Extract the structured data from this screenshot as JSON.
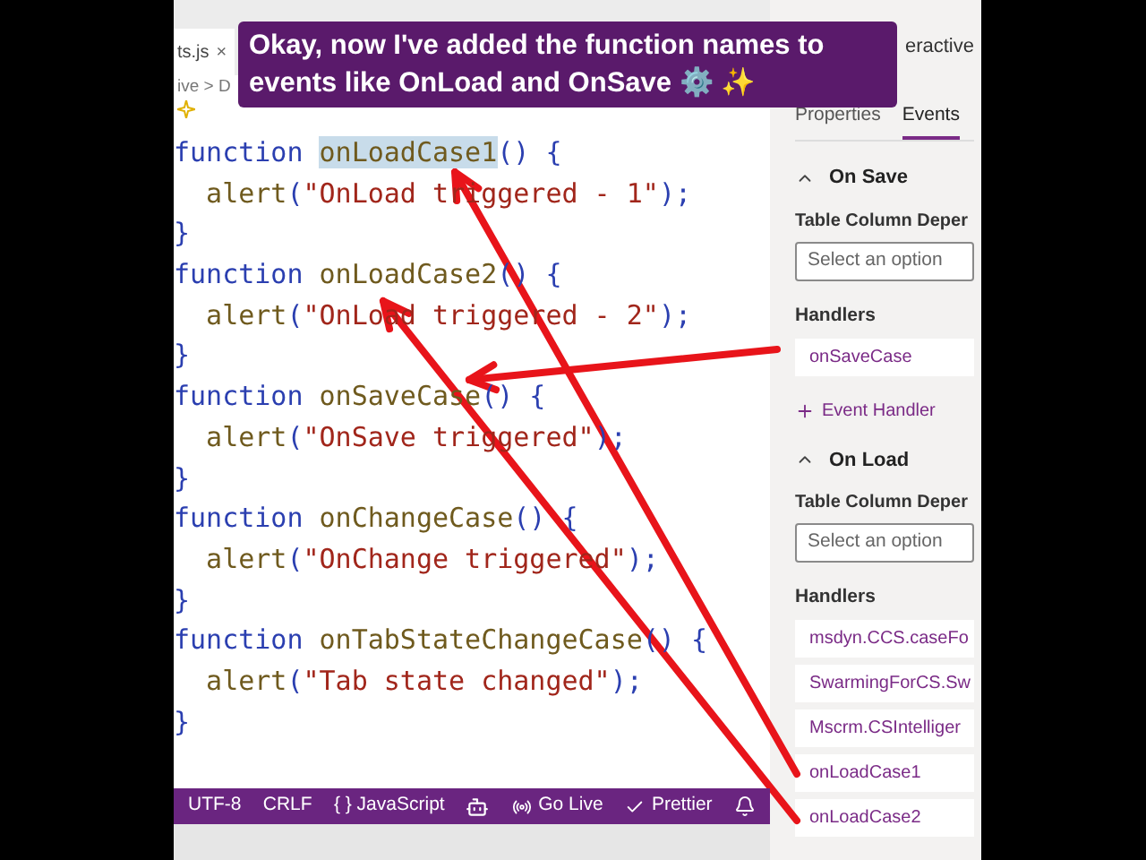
{
  "caption": "Okay, now I've added the function names to events like OnLoad and OnSave ⚙️ ✨",
  "editor": {
    "tab": {
      "label": "ts.js",
      "close": "×"
    },
    "breadcrumb": "ive > D",
    "code_lines": [
      {
        "tokens": [
          {
            "kind": "keyword",
            "text": "function "
          },
          {
            "kind": "name",
            "text": "onLoadCase1",
            "highlighted": true
          },
          {
            "kind": "punct",
            "text": "() {"
          }
        ]
      },
      {
        "tokens": [
          {
            "kind": "call",
            "text": "  alert"
          },
          {
            "kind": "punct",
            "text": "("
          },
          {
            "kind": "string",
            "text": "\"OnLoad triggered - 1\""
          },
          {
            "kind": "punct",
            "text": ");"
          }
        ]
      },
      {
        "tokens": [
          {
            "kind": "punct",
            "text": "}"
          }
        ]
      },
      {
        "tokens": [
          {
            "kind": "keyword",
            "text": "function "
          },
          {
            "kind": "name",
            "text": "onLoadCase2",
            "highlighted": false
          },
          {
            "kind": "punct",
            "text": "() {"
          }
        ]
      },
      {
        "tokens": [
          {
            "kind": "call",
            "text": "  alert"
          },
          {
            "kind": "punct",
            "text": "("
          },
          {
            "kind": "string",
            "text": "\"OnLoad triggered - 2\""
          },
          {
            "kind": "punct",
            "text": ");"
          }
        ]
      },
      {
        "tokens": [
          {
            "kind": "punct",
            "text": "}"
          }
        ]
      },
      {
        "tokens": [
          {
            "kind": "keyword",
            "text": "function "
          },
          {
            "kind": "name",
            "text": "onSaveCase",
            "highlighted": false
          },
          {
            "kind": "punct",
            "text": "() {"
          }
        ]
      },
      {
        "tokens": [
          {
            "kind": "call",
            "text": "  alert"
          },
          {
            "kind": "punct",
            "text": "("
          },
          {
            "kind": "string",
            "text": "\"OnSave triggered\""
          },
          {
            "kind": "punct",
            "text": ");"
          }
        ]
      },
      {
        "tokens": [
          {
            "kind": "punct",
            "text": "}"
          }
        ]
      },
      {
        "tokens": [
          {
            "kind": "keyword",
            "text": "function "
          },
          {
            "kind": "name",
            "text": "onChangeCase",
            "highlighted": false
          },
          {
            "kind": "punct",
            "text": "() {"
          }
        ]
      },
      {
        "tokens": [
          {
            "kind": "call",
            "text": "  alert"
          },
          {
            "kind": "punct",
            "text": "("
          },
          {
            "kind": "string",
            "text": "\"OnChange triggered\""
          },
          {
            "kind": "punct",
            "text": ");"
          }
        ]
      },
      {
        "tokens": [
          {
            "kind": "punct",
            "text": "}"
          }
        ]
      },
      {
        "tokens": [
          {
            "kind": "keyword",
            "text": "function "
          },
          {
            "kind": "name",
            "text": "onTabStateChangeCase",
            "highlighted": false
          },
          {
            "kind": "punct",
            "text": "() {"
          }
        ]
      },
      {
        "tokens": [
          {
            "kind": "call",
            "text": "  alert"
          },
          {
            "kind": "punct",
            "text": "("
          },
          {
            "kind": "string",
            "text": "\"Tab state changed\""
          },
          {
            "kind": "punct",
            "text": ");"
          }
        ]
      },
      {
        "tokens": [
          {
            "kind": "punct",
            "text": "}"
          }
        ]
      }
    ]
  },
  "status_bar": [
    {
      "kind": "text",
      "text": "UTF-8"
    },
    {
      "kind": "text",
      "text": "CRLF"
    },
    {
      "kind": "text",
      "text": "{ } JavaScript"
    },
    {
      "kind": "copilot"
    },
    {
      "kind": "golive",
      "text": "Go Live"
    },
    {
      "kind": "prettier",
      "text": "Prettier"
    },
    {
      "kind": "bell"
    }
  ],
  "panel": {
    "title": "eractive",
    "tabs": [
      {
        "label": "Properties",
        "selected": false
      },
      {
        "label": "Events",
        "selected": true
      }
    ],
    "sections": [
      {
        "title": "On Save",
        "expanded": true,
        "field_label": "Table Column Deper",
        "placeholder": "Select an option",
        "handlers_label": "Handlers",
        "handlers": [
          "onSaveCase"
        ],
        "add_link": "Event Handler"
      },
      {
        "title": "On Load",
        "expanded": true,
        "field_label": "Table Column Deper",
        "placeholder": "Select an option",
        "handlers_label": "Handlers",
        "handlers": [
          "msdyn.CCS.caseFo",
          "SwarmingForCS.Sw",
          "Mscrm.CSIntelliger",
          "onLoadCase1",
          "onLoadCase2"
        ]
      }
    ]
  }
}
